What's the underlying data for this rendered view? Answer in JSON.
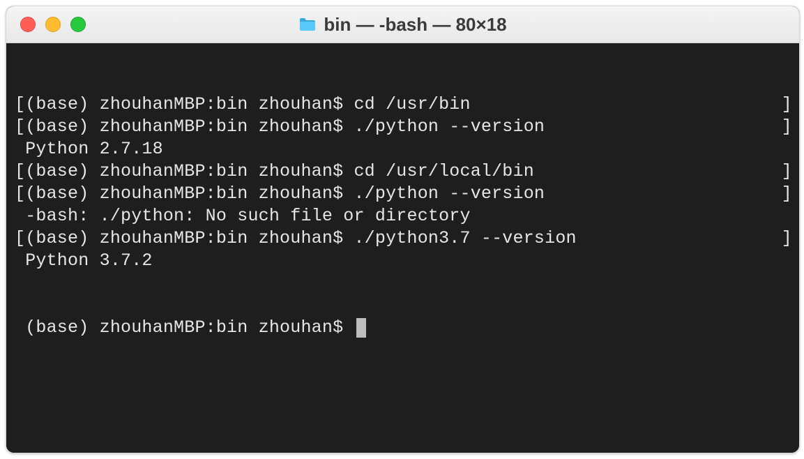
{
  "window": {
    "title": "bin — -bash — 80×18"
  },
  "terminal": {
    "brackets": {
      "l": "[",
      "r": "]"
    },
    "prompt": "(base) zhouhanMBP:bin zhouhan$ ",
    "lines": [
      {
        "text": "(base) zhouhanMBP:bin zhouhan$ cd /usr/bin",
        "bracketed": true
      },
      {
        "text": "(base) zhouhanMBP:bin zhouhan$ ./python --version",
        "bracketed": true
      },
      {
        "text": " Python 2.7.18",
        "bracketed": false
      },
      {
        "text": "(base) zhouhanMBP:bin zhouhan$ cd /usr/local/bin",
        "bracketed": true
      },
      {
        "text": "(base) zhouhanMBP:bin zhouhan$ ./python --version",
        "bracketed": true
      },
      {
        "text": " -bash: ./python: No such file or directory",
        "bracketed": false
      },
      {
        "text": "(base) zhouhanMBP:bin zhouhan$ ./python3.7 --version",
        "bracketed": true
      },
      {
        "text": " Python 3.7.2",
        "bracketed": false
      }
    ],
    "current_prompt": " (base) zhouhanMBP:bin zhouhan$ "
  }
}
